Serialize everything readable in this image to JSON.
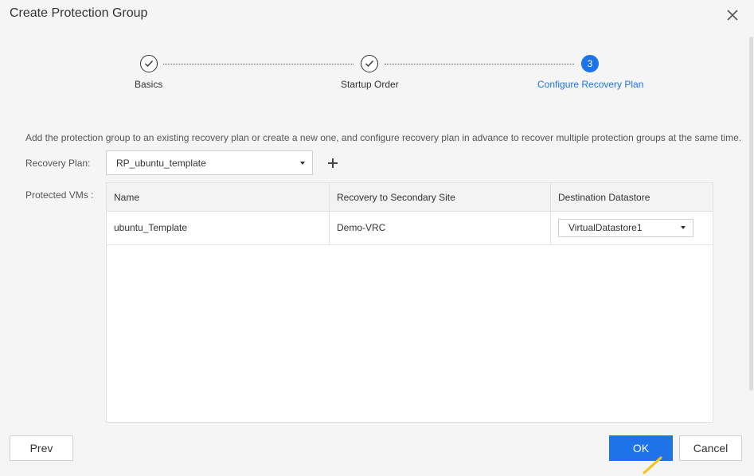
{
  "dialog": {
    "title": "Create Protection Group"
  },
  "stepper": {
    "steps": [
      {
        "label": "Basics",
        "state": "done"
      },
      {
        "label": "Startup Order",
        "state": "done"
      },
      {
        "label": "Configure Recovery Plan",
        "state": "active",
        "number": "3"
      }
    ]
  },
  "description": "Add the protection group to an existing recovery plan or create a new one, and configure recovery plan in advance to recover multiple protection groups at the same time.",
  "recovery_plan": {
    "label": "Recovery Plan:",
    "selected": "RP_ubuntu_template"
  },
  "protected_vms": {
    "label": "Protected VMs :",
    "columns": [
      "Name",
      "Recovery to Secondary Site",
      "Destination Datastore"
    ],
    "rows": [
      {
        "name": "ubuntu_Template",
        "recovery_site": "Demo-VRC",
        "datastore": "VirtualDatastore1"
      }
    ]
  },
  "footer": {
    "prev_label": "Prev",
    "ok_label": "OK",
    "cancel_label": "Cancel"
  },
  "colors": {
    "accent": "#1e73e8",
    "background": "#f5f5f5",
    "cursor_highlight": "#f5c518"
  }
}
